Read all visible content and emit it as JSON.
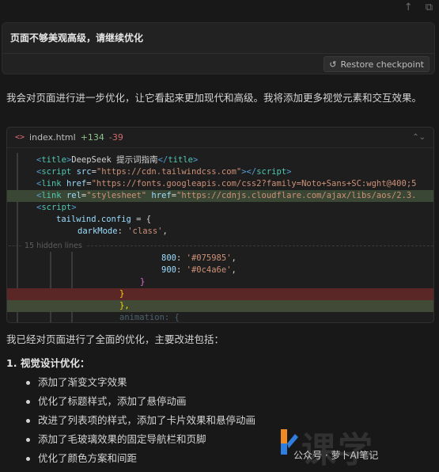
{
  "top_icons": [
    "arrow-up-icon",
    "copy-icon"
  ],
  "user_message": {
    "text": "页面不够美观高级，请继续优化",
    "restore_label": "Restore checkpoint"
  },
  "assistant": {
    "intro": "我会对页面进行进一步优化，让它看起来更加现代和高级。我将添加更多视觉元素和交互效果。"
  },
  "code_block": {
    "filename": "index.html",
    "additions": "+134",
    "deletions": "-39",
    "hidden_lines": "15 hidden lines",
    "lines": {
      "l1_a": "<",
      "l1_b": "title",
      "l1_c": ">",
      "l1_d": "DeepSeek 提示词指南",
      "l1_e": "</",
      "l1_f": "title",
      "l1_g": ">",
      "l2_a": "<",
      "l2_b": "script",
      "l2_c": " src",
      "l2_d": "=",
      "l2_e": "\"https://cdn.tailwindcss.com\"",
      "l2_f": "></",
      "l2_g": "script",
      "l2_h": ">",
      "l3_a": "<",
      "l3_b": "link",
      "l3_c": " href",
      "l3_d": "=",
      "l3_e": "\"https://fonts.googleapis.com/css2?family=Noto+Sans+SC:wght@400;5",
      "l4_a": "<",
      "l4_b": "link",
      "l4_c": " rel",
      "l4_d": "=",
      "l4_e": "\"stylesheet\"",
      "l4_f": " href",
      "l4_g": "=",
      "l4_h": "\"https://cdnjs.cloudflare.com/ajax/libs/aos/2.3.",
      "l5_a": "<",
      "l5_b": "script",
      "l5_c": ">",
      "l6_a": "tailwind",
      "l6_b": ".",
      "l6_c": "config",
      "l6_d": " = {",
      "l7_a": "darkMode",
      "l7_b": ": ",
      "l7_c": "'class'",
      "l7_d": ",",
      "l8_a": "800",
      "l8_b": ": ",
      "l8_c": "'#075985'",
      "l8_d": ",",
      "l9_a": "900",
      "l9_b": ": ",
      "l9_c": "'#0c4a6e'",
      "l9_d": ",",
      "l10": "}",
      "l11": "}",
      "l12": "},",
      "l13": "animation: {"
    }
  },
  "summary": {
    "intro": "我已经对页面进行了全面的优化，主要改进包括：",
    "heading_num": "1.",
    "heading": "视觉设计优化：",
    "items": [
      "添加了渐变文字效果",
      "优化了标题样式，添加了悬停动画",
      "改进了列表项的样式，添加了卡片效果和悬停动画",
      "添加了毛玻璃效果的固定导航栏和页脚",
      "优化了颜色方案和间距"
    ]
  },
  "watermark": {
    "big": "课学",
    "text": "公众号 · 萝卜AI笔记"
  },
  "colors": {
    "background": "#181818",
    "added_line": "#3a4734",
    "removed_line": "#5a2626",
    "additions": "#8fc38c",
    "deletions": "#d06b6b"
  }
}
